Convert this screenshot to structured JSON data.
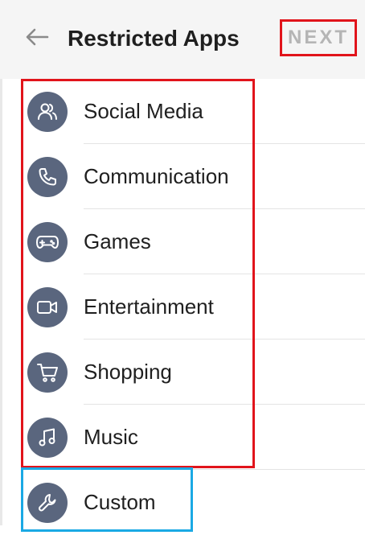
{
  "header": {
    "title": "Restricted Apps",
    "next_label": "NEXT"
  },
  "colors": {
    "icon_bg": "#5a667e",
    "highlight_red": "#e1141b",
    "highlight_blue": "#1aa9e4"
  },
  "categories": [
    {
      "label": "Social Media",
      "icon": "people-icon"
    },
    {
      "label": "Communication",
      "icon": "phone-icon"
    },
    {
      "label": "Games",
      "icon": "gamepad-icon"
    },
    {
      "label": "Entertainment",
      "icon": "video-camera-icon"
    },
    {
      "label": "Shopping",
      "icon": "shopping-cart-icon"
    },
    {
      "label": "Music",
      "icon": "music-note-icon"
    },
    {
      "label": "Custom",
      "icon": "wrench-icon"
    }
  ]
}
